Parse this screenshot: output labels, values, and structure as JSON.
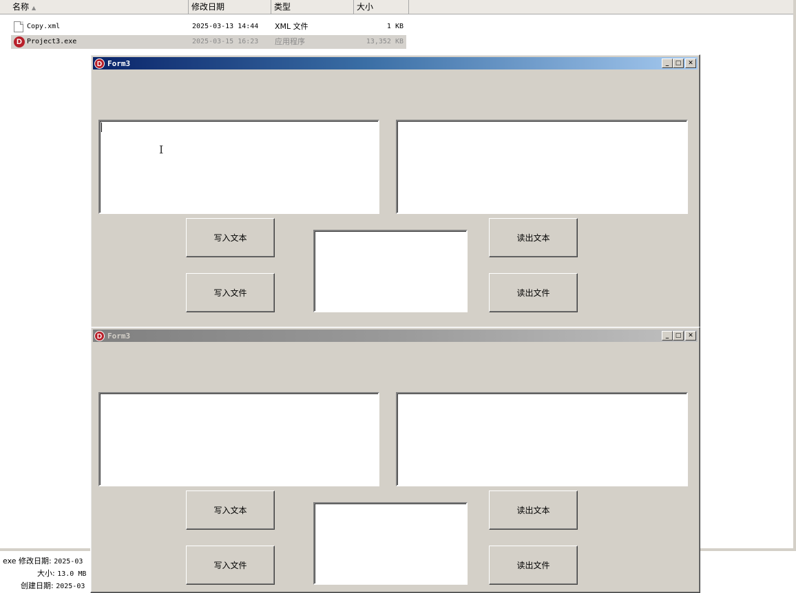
{
  "explorer": {
    "columns": {
      "name": "名称",
      "date": "修改日期",
      "type": "类型",
      "size": "大小"
    },
    "files": [
      {
        "name": "Copy.xml",
        "date": "2025-03-13 14:44",
        "type": "XML 文件",
        "size": "1 KB",
        "icon": "xml-file-icon"
      },
      {
        "name": "Project3.exe",
        "date": "2025-03-15 16:23",
        "type": "应用程序",
        "size": "13,352 KB",
        "icon": "delphi-app-icon"
      }
    ],
    "details": {
      "line1_label": "exe 修改日期:",
      "line1_value": "2025-03",
      "line2_label": "大小:",
      "line2_value": "13.0 MB",
      "line3_label": "创建日期:",
      "line3_value": "2025-03"
    }
  },
  "forms": [
    {
      "title": "Form3",
      "state": "active",
      "buttons": {
        "write_text": "写入文本",
        "read_text": "读出文本",
        "write_file": "写入文件",
        "read_file": "读出文件"
      },
      "memo_left": "",
      "memo_right": "",
      "memo_center": ""
    },
    {
      "title": "Form3",
      "state": "inactive",
      "buttons": {
        "write_text": "写入文本",
        "read_text": "读出文本",
        "write_file": "写入文件",
        "read_file": "读出文件"
      },
      "memo_left": "",
      "memo_right": "",
      "memo_center": ""
    }
  ],
  "title_buttons": {
    "minimize": "_",
    "maximize": "□",
    "close": "✕"
  }
}
